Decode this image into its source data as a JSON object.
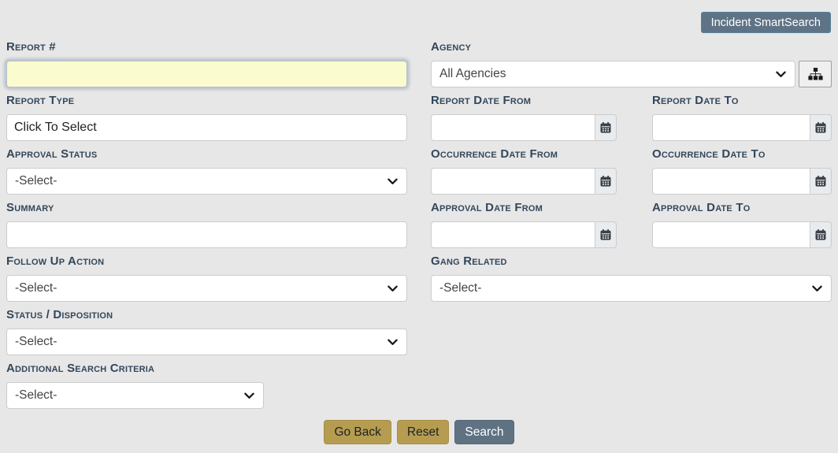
{
  "header": {
    "smart_search_button": "Incident SmartSearch"
  },
  "form": {
    "left": {
      "report_number": {
        "label": "Report #",
        "value": ""
      },
      "report_type": {
        "label": "Report Type",
        "value": "Click To Select"
      },
      "approval_status": {
        "label": "Approval Status",
        "selected": "-Select-"
      },
      "summary": {
        "label": "Summary",
        "value": ""
      },
      "follow_up_action": {
        "label": "Follow Up Action",
        "selected": "-Select-"
      },
      "status_disposition": {
        "label": "Status / Disposition",
        "selected": "-Select-"
      },
      "additional_search_criteria": {
        "label": "Additional Search Criteria",
        "selected": "-Select-"
      }
    },
    "right": {
      "agency": {
        "label": "Agency",
        "selected": "All Agencies"
      },
      "report_date_from": {
        "label": "Report Date From",
        "value": ""
      },
      "report_date_to": {
        "label": "Report Date To",
        "value": ""
      },
      "occurrence_date_from": {
        "label": "Occurrence Date From",
        "value": ""
      },
      "occurrence_date_to": {
        "label": "Occurrence Date To",
        "value": ""
      },
      "approval_date_from": {
        "label": "Approval Date From",
        "value": ""
      },
      "approval_date_to": {
        "label": "Approval Date To",
        "value": ""
      },
      "gang_related": {
        "label": "Gang Related",
        "selected": "-Select-"
      }
    },
    "actions": {
      "go_back": "Go Back",
      "reset": "Reset",
      "search": "Search"
    }
  },
  "icons": {
    "select_indicator": "chevron-down",
    "date_picker": "calendar",
    "agency_picker": "sitemap"
  },
  "colors": {
    "page_background": "#e7e7e7",
    "label_text": "#33475b",
    "highlight_input": "#fbfbd0",
    "button_tan": "#b59c50",
    "button_slate": "#5f7282",
    "smartsearch_button": "#5e7486",
    "addon_background": "#e9ecef"
  }
}
